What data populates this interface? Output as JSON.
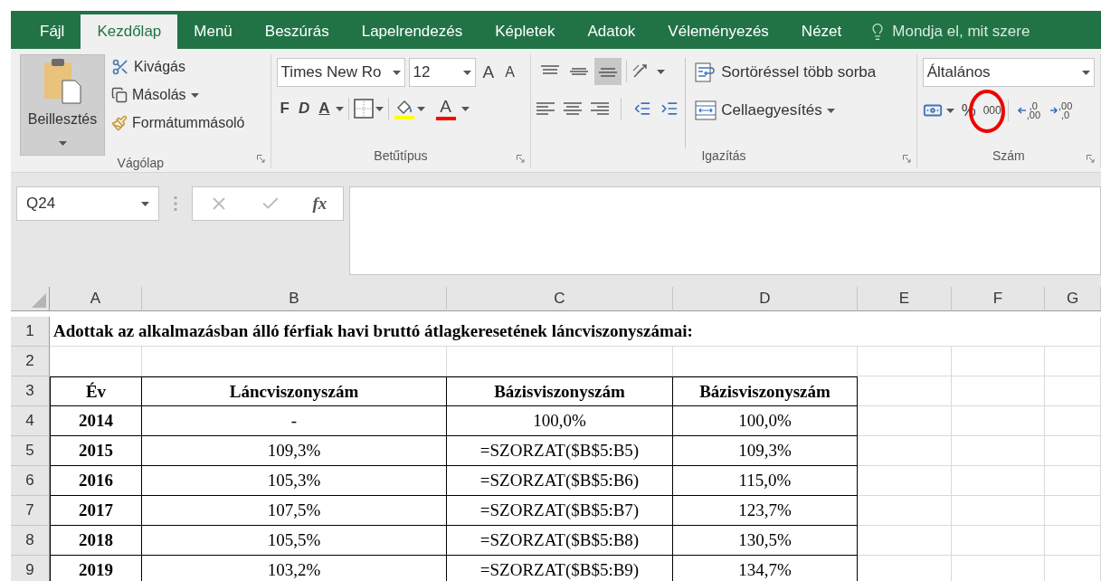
{
  "tabs": [
    {
      "label": "Fájl",
      "selected": false
    },
    {
      "label": "Kezdőlap",
      "selected": true
    },
    {
      "label": "Menü",
      "selected": false
    },
    {
      "label": "Beszúrás",
      "selected": false
    },
    {
      "label": "Lapelrendezés",
      "selected": false
    },
    {
      "label": "Képletek",
      "selected": false
    },
    {
      "label": "Adatok",
      "selected": false
    },
    {
      "label": "Véleményezés",
      "selected": false
    },
    {
      "label": "Nézet",
      "selected": false
    }
  ],
  "tell_me": "Mondja el, mit szere",
  "ribbon": {
    "clipboard": {
      "paste": "Beillesztés",
      "cut": "Kivágás",
      "copy": "Másolás",
      "format_painter": "Formátummásoló",
      "group": "Vágólap"
    },
    "font": {
      "font_name": "Times New Ro",
      "font_size": "12",
      "grow": "A",
      "shrink": "A",
      "bold": "F",
      "italic": "D",
      "underline": "A",
      "font_color_letter": "A",
      "group": "Betűtípus"
    },
    "alignment": {
      "vertical": [
        {
          "selected": false
        },
        {
          "selected": false
        },
        {
          "selected": true
        }
      ],
      "wrap": "Sortöréssel több sorba",
      "merge": "Cellaegyesítés",
      "group": "Igazítás"
    },
    "number": {
      "format": "Általános",
      "percent": "%",
      "thousands": "000",
      "increase_decimal": [
        ",0",
        ",00"
      ],
      "decrease_decimal": [
        ",00",
        ",0"
      ],
      "group": "Szám"
    }
  },
  "name_box": "Q24",
  "function_label": "fx",
  "columns": [
    "A",
    "B",
    "C",
    "D",
    "E",
    "F",
    "G"
  ],
  "rows": [
    {
      "number": "1",
      "kind": "title",
      "cells": [
        "Adottak az alkalmazásban álló férfiak havi bruttó átlagkeresetének láncviszonyszámai:"
      ]
    },
    {
      "number": "2",
      "kind": "blank"
    },
    {
      "number": "3",
      "kind": "header",
      "cells": [
        "Év",
        "Láncviszonyszám",
        "Bázisviszonyszám",
        "Bázisviszonyszám"
      ]
    },
    {
      "number": "4",
      "kind": "data",
      "cells": [
        "2014",
        "-",
        "100,0%",
        "100,0%"
      ]
    },
    {
      "number": "5",
      "kind": "data",
      "cells": [
        "2015",
        "109,3%",
        "=SZORZAT($B$5:B5)",
        "109,3%"
      ]
    },
    {
      "number": "6",
      "kind": "data",
      "cells": [
        "2016",
        "105,3%",
        "=SZORZAT($B$5:B6)",
        "115,0%"
      ]
    },
    {
      "number": "7",
      "kind": "data",
      "cells": [
        "2017",
        "107,5%",
        "=SZORZAT($B$5:B7)",
        "123,7%"
      ]
    },
    {
      "number": "8",
      "kind": "data",
      "cells": [
        "2018",
        "105,5%",
        "=SZORZAT($B$5:B8)",
        "130,5%"
      ]
    },
    {
      "number": "9",
      "kind": "data",
      "cells": [
        "2019",
        "103,2%",
        "=SZORZAT($B$5:B9)",
        "134,7%"
      ]
    }
  ]
}
